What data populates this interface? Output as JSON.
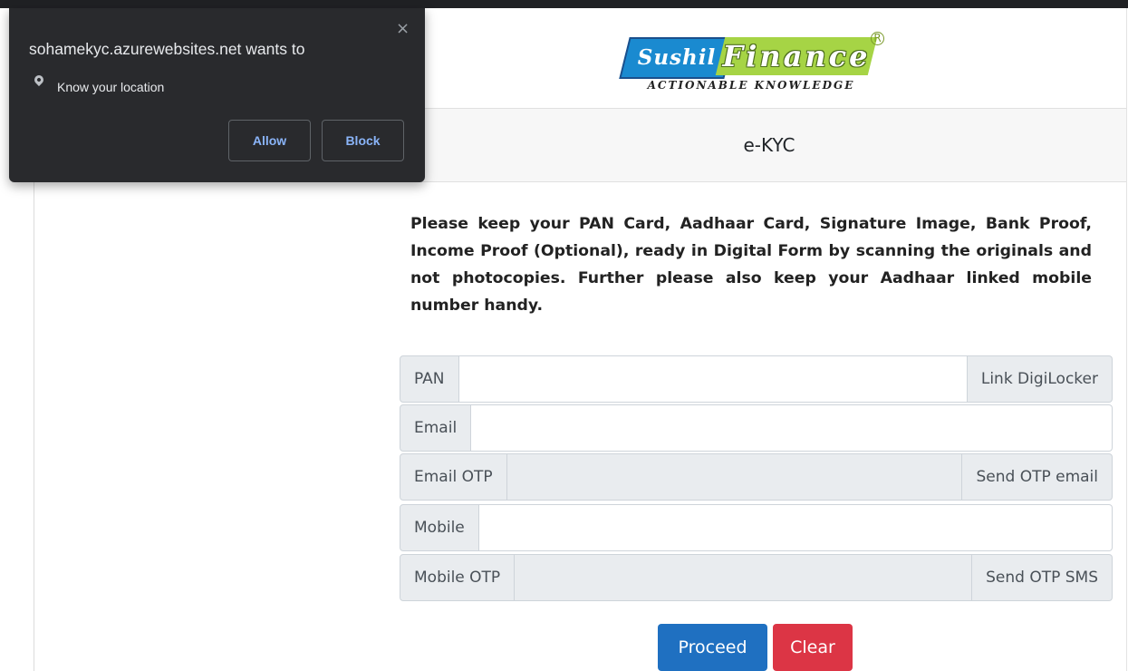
{
  "permission_prompt": {
    "site_text": "sohamekyc.azurewebsites.net wants to",
    "permission_text": "Know your location",
    "close_glyph": "×",
    "allow_label": "Allow",
    "block_label": "Block",
    "location_icon": "location-pin-icon"
  },
  "logo": {
    "brand_left": "Sushil",
    "brand_right": "Finance",
    "registered": "R",
    "tagline": "ACTIONABLE KNOWLEDGE",
    "colors": {
      "left_bg": "#1a8ad0",
      "right_bg": "#a6d445"
    }
  },
  "header": {
    "title": "e-KYC"
  },
  "instructions": "Please keep your PAN Card, Aadhaar Card, Signature Image, Bank Proof, Income Proof (Optional), ready in Digital Form by scanning the originals and not photocopies. Further please also keep your Aadhaar linked mobile number handy.",
  "form": {
    "pan": {
      "label": "PAN",
      "value": "",
      "action_label": "Link DigiLocker"
    },
    "email": {
      "label": "Email",
      "value": ""
    },
    "email_otp": {
      "label": "Email OTP",
      "value": "",
      "action_label": "Send OTP email"
    },
    "mobile": {
      "label": "Mobile",
      "value": ""
    },
    "mobile_otp": {
      "label": "Mobile OTP",
      "value": "",
      "action_label": "Send OTP SMS"
    }
  },
  "buttons": {
    "proceed_label": "Proceed",
    "clear_label": "Clear",
    "colors": {
      "proceed": "#1f70c1",
      "clear": "#dc3545"
    }
  }
}
